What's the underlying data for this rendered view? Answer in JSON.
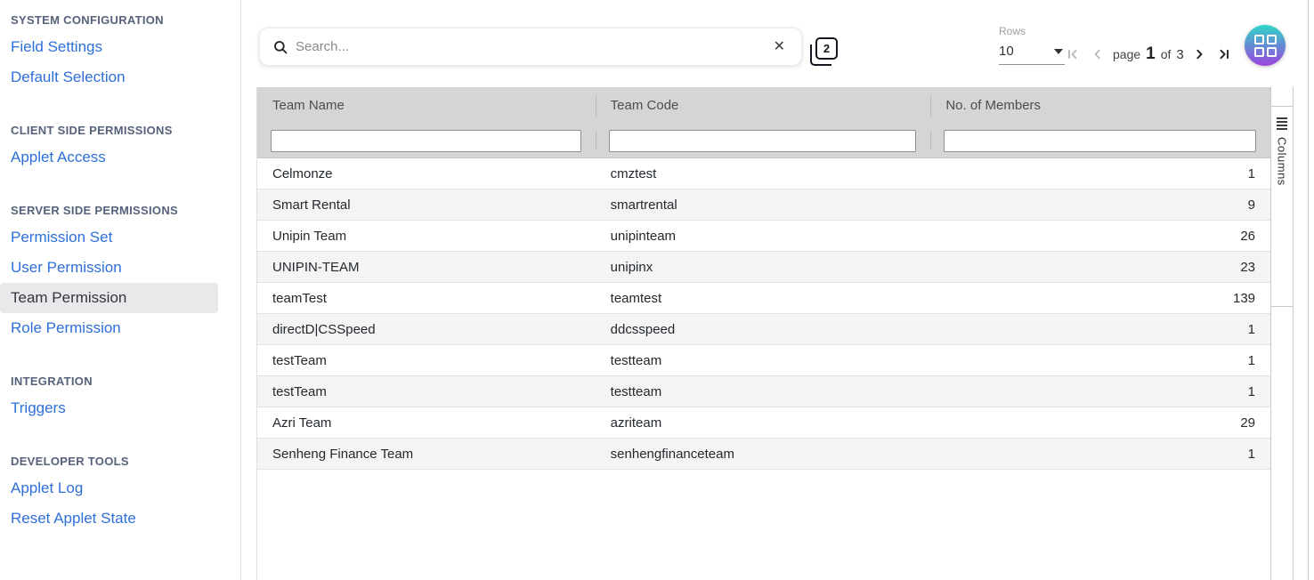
{
  "sidebar": {
    "sections": [
      {
        "header": "SYSTEM CONFIGURATION",
        "items": [
          {
            "label": "Field Settings"
          },
          {
            "label": "Default Selection"
          }
        ]
      },
      {
        "header": "CLIENT SIDE PERMISSIONS",
        "items": [
          {
            "label": "Applet Access"
          }
        ]
      },
      {
        "header": "SERVER SIDE PERMISSIONS",
        "items": [
          {
            "label": "Permission Set"
          },
          {
            "label": "User Permission"
          },
          {
            "label": "Team Permission",
            "selected": true
          },
          {
            "label": "Role Permission"
          }
        ]
      },
      {
        "header": "INTEGRATION",
        "items": [
          {
            "label": "Triggers"
          }
        ]
      },
      {
        "header": "DEVELOPER TOOLS",
        "items": [
          {
            "label": "Applet Log"
          },
          {
            "label": "Reset Applet State"
          }
        ]
      }
    ]
  },
  "toolbar": {
    "search": {
      "placeholder": "Search...",
      "value": "",
      "clear_label": "✕"
    },
    "duplicate_icon_number": "2",
    "rows": {
      "label": "Rows",
      "value": "10"
    },
    "pagination": {
      "page_word": "page",
      "current": "1",
      "of_word": "of",
      "total": "3"
    }
  },
  "table": {
    "columns": [
      "Team Name",
      "Team Code",
      "No. of Members"
    ],
    "rows": [
      {
        "name": "Celmonze",
        "code": "cmztest",
        "members": "1"
      },
      {
        "name": "Smart Rental",
        "code": "smartrental",
        "members": "9"
      },
      {
        "name": "Unipin Team",
        "code": "unipinteam",
        "members": "26"
      },
      {
        "name": "UNIPIN-TEAM",
        "code": "unipinx",
        "members": "23"
      },
      {
        "name": "teamTest",
        "code": "teamtest",
        "members": "139"
      },
      {
        "name": "directD|CSSpeed",
        "code": "ddcsspeed",
        "members": "1"
      },
      {
        "name": "testTeam",
        "code": "testteam",
        "members": "1"
      },
      {
        "name": "testTeam",
        "code": "testteam",
        "members": "1"
      },
      {
        "name": "Azri Team",
        "code": "azriteam",
        "members": "29"
      },
      {
        "name": "Senheng Finance Team",
        "code": "senhengfinanceteam",
        "members": "1"
      }
    ]
  },
  "columns_rail": {
    "label": "Columns"
  },
  "colors": {
    "link_blue": "#2e6fd9",
    "selected_item_bg": "#e9e9eb",
    "table_header_bg": "#d5d5d5",
    "grid_button_gradient_top": "#2fd5c8",
    "grid_button_gradient_bottom": "#9c44de"
  }
}
